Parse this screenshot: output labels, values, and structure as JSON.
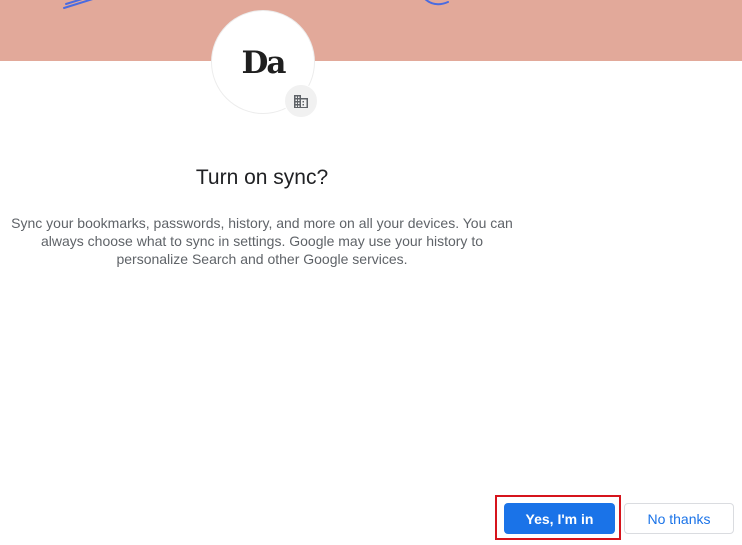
{
  "avatar": {
    "logo_text": "Da",
    "badge_icon": "building-icon"
  },
  "dialog": {
    "title": "Turn on sync?",
    "description": "Sync your bookmarks, passwords, history, and more on all your devices. You can always choose what to sync in settings. Google may use your history to personalize Search and other Google services."
  },
  "buttons": {
    "confirm_label": "Yes, I'm in",
    "decline_label": "No thanks"
  },
  "colors": {
    "banner": "#e2a99a",
    "accent": "#1a73e8",
    "highlight": "#d6141c"
  }
}
